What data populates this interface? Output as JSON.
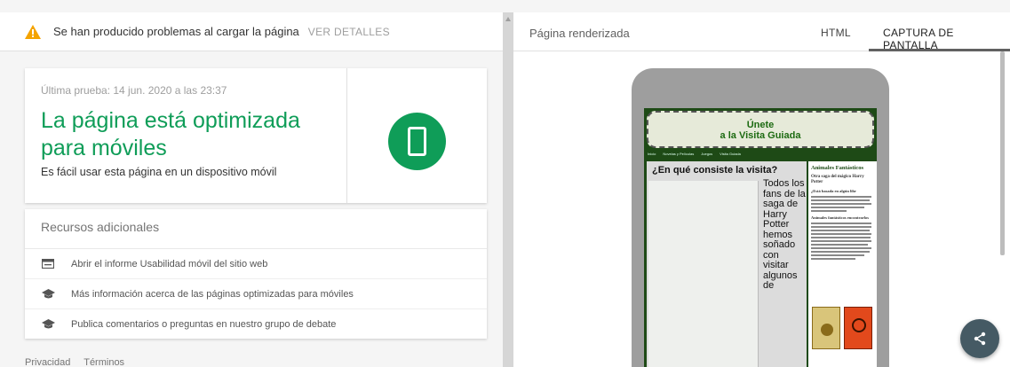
{
  "warning": {
    "message": "Se han producido problemas al cargar la página",
    "details_link": "VER DETALLES",
    "icon": "warning-triangle-icon"
  },
  "result": {
    "last_test": "Última prueba: 14 jun. 2020 a las 23:37",
    "headline": "La página está optimizada para móviles",
    "description": "Es fácil usar esta página en un dispositivo móvil",
    "icon": "mobile-phone-icon",
    "accent_color": "#0f9d58"
  },
  "resources": {
    "title": "Recursos adicionales",
    "items": [
      {
        "label": "Abrir el informe Usabilidad móvil del sitio web",
        "icon": "report-icon"
      },
      {
        "label": "Más información acerca de las páginas optimizadas para móviles",
        "icon": "graduation-cap-icon"
      },
      {
        "label": "Publica comentarios o preguntas en nuestro grupo de debate",
        "icon": "graduation-cap-icon"
      }
    ]
  },
  "footer": {
    "privacy": "Privacidad",
    "terms": "Términos"
  },
  "render_panel": {
    "title": "Página renderizada",
    "tabs": [
      "HTML",
      "CAPTURA DE PANTALLA"
    ],
    "active_tab": "CAPTURA DE PANTALLA"
  },
  "preview": {
    "header_line1": "Únete",
    "header_line2": "a la Visita Guiada",
    "nav": [
      "Inicio",
      "Novelas y Películas",
      "Juegos",
      "Visita Guiada"
    ],
    "question": "¿En qué consiste la visita?",
    "body": "Todos los fans de la saga de Harry Potter hemos soñado con visitar algunos de",
    "side_title": "Animales Fantásticos",
    "side_subtitle": "Otra saga del mágico Harry Potter",
    "side_question": "¿Está basada en algún libr",
    "side_bold": "Animales fantásticos encontrarlos"
  },
  "share_button": {
    "icon": "share-icon"
  }
}
